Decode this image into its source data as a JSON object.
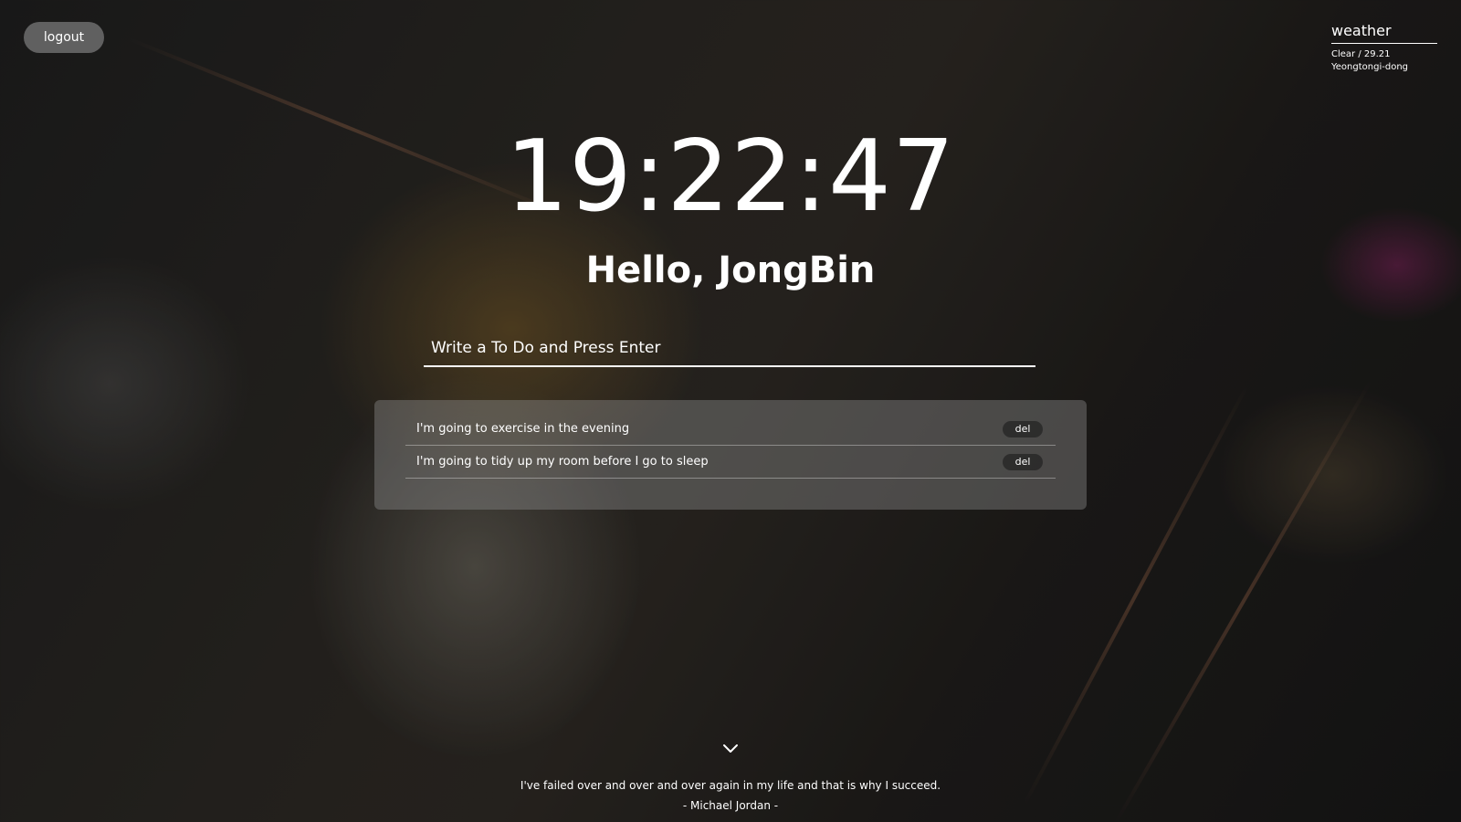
{
  "header": {
    "logout_label": "logout"
  },
  "weather": {
    "title": "weather",
    "condition_temp": "Clear / 29.21",
    "location": "Yeongtongi-dong"
  },
  "clock": {
    "time": "19:22:47"
  },
  "greeting": {
    "text": "Hello, JongBin"
  },
  "todo": {
    "placeholder": "Write a To Do and Press Enter",
    "value": "",
    "delete_label": "del",
    "items": [
      {
        "text": "I'm going to exercise in the evening"
      },
      {
        "text": "I'm going to tidy up my room before I go to sleep"
      }
    ]
  },
  "quote": {
    "text": "I've failed over and over and over again in my life and that is why I succeed.",
    "author": "- Michael Jordan -"
  },
  "icons": {
    "scroll": "chevron-down-icon"
  }
}
